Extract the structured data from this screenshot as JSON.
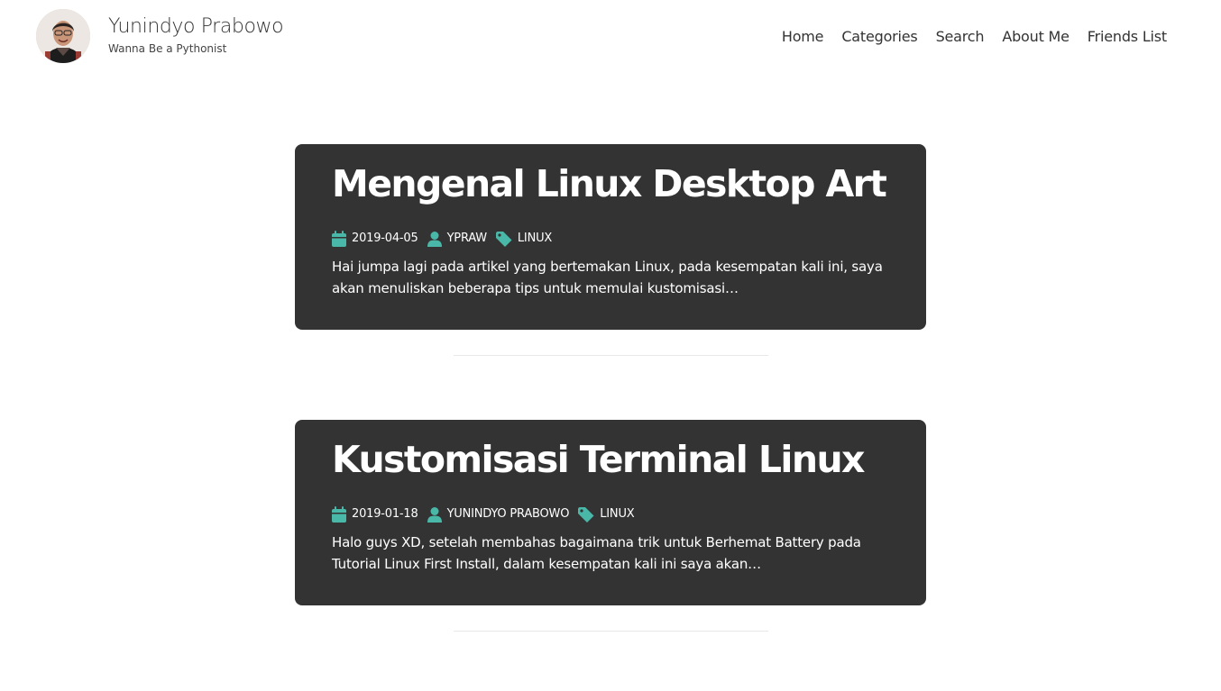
{
  "site": {
    "title": "Yunindyo Prabowo",
    "subtitle": "Wanna Be a Pythonist"
  },
  "nav": {
    "items": [
      {
        "label": "Home"
      },
      {
        "label": "Categories"
      },
      {
        "label": "Search"
      },
      {
        "label": "About Me"
      },
      {
        "label": "Friends List"
      }
    ]
  },
  "posts": [
    {
      "title": "Mengenal Linux Desktop Art",
      "date": "2019-04-05",
      "author": "YPRAW",
      "category": "LINUX",
      "excerpt": "Hai jumpa lagi pada artikel yang bertemakan Linux, pada kesempatan kali ini, saya akan menuliskan beberapa tips untuk memulai kustomisasi…"
    },
    {
      "title": "Kustomisasi Terminal Linux",
      "date": "2019-01-18",
      "author": "YUNINDYO PRABOWO",
      "category": "LINUX",
      "excerpt": "Halo guys XD, setelah membahas bagaimana trik untuk Berhemat Battery pada Tutorial Linux First Install, dalam kesempatan kali ini saya akan…"
    }
  ],
  "icons": {
    "date": "calendar-icon",
    "author": "user-icon",
    "category": "tag-icon"
  },
  "colors": {
    "accent": "#4ab8a8",
    "card_background": "#333333",
    "text": "#333333"
  }
}
